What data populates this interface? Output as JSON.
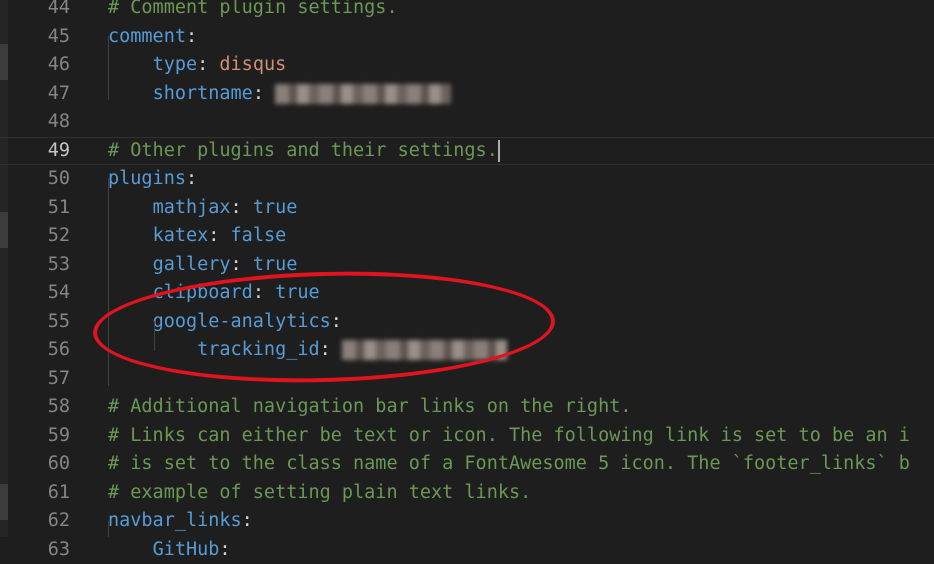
{
  "lines": [
    {
      "num": "44",
      "segments": [
        {
          "t": "c",
          "text": "# Comment plugin settings."
        }
      ]
    },
    {
      "num": "45",
      "segments": [
        {
          "t": "k",
          "text": "comment"
        },
        {
          "t": "p",
          "text": ":"
        }
      ]
    },
    {
      "num": "46",
      "segments": [
        {
          "t": "p",
          "text": "    "
        },
        {
          "t": "k",
          "text": "type"
        },
        {
          "t": "p",
          "text": ": "
        },
        {
          "t": "v",
          "text": "disqus"
        }
      ]
    },
    {
      "num": "47",
      "segments": [
        {
          "t": "p",
          "text": "    "
        },
        {
          "t": "k",
          "text": "shortname"
        },
        {
          "t": "p",
          "text": ": "
        },
        {
          "t": "redacted",
          "text": ""
        }
      ]
    },
    {
      "num": "48",
      "segments": []
    },
    {
      "num": "49",
      "current": true,
      "segments": [
        {
          "t": "c",
          "text": "# Other plugins and their settings."
        },
        {
          "t": "cursor",
          "text": ""
        }
      ]
    },
    {
      "num": "50",
      "segments": [
        {
          "t": "k",
          "text": "plugins"
        },
        {
          "t": "p",
          "text": ":"
        }
      ]
    },
    {
      "num": "51",
      "segments": [
        {
          "t": "p",
          "text": "    "
        },
        {
          "t": "k",
          "text": "mathjax"
        },
        {
          "t": "p",
          "text": ": "
        },
        {
          "t": "b",
          "text": "true"
        }
      ]
    },
    {
      "num": "52",
      "segments": [
        {
          "t": "p",
          "text": "    "
        },
        {
          "t": "k",
          "text": "katex"
        },
        {
          "t": "p",
          "text": ": "
        },
        {
          "t": "b",
          "text": "false"
        }
      ]
    },
    {
      "num": "53",
      "segments": [
        {
          "t": "p",
          "text": "    "
        },
        {
          "t": "k",
          "text": "gallery"
        },
        {
          "t": "p",
          "text": ": "
        },
        {
          "t": "b",
          "text": "true"
        }
      ]
    },
    {
      "num": "54",
      "segments": [
        {
          "t": "p",
          "text": "    "
        },
        {
          "t": "k",
          "text": "clipboard"
        },
        {
          "t": "p",
          "text": ": "
        },
        {
          "t": "b",
          "text": "true"
        }
      ]
    },
    {
      "num": "55",
      "segments": [
        {
          "t": "p",
          "text": "    "
        },
        {
          "t": "k",
          "text": "google-analytics"
        },
        {
          "t": "p",
          "text": ":"
        }
      ]
    },
    {
      "num": "56",
      "segments": [
        {
          "t": "p",
          "text": "        "
        },
        {
          "t": "k",
          "text": "tracking_id"
        },
        {
          "t": "p",
          "text": ": "
        },
        {
          "t": "redacted",
          "text": ""
        }
      ]
    },
    {
      "num": "57",
      "segments": []
    },
    {
      "num": "58",
      "segments": [
        {
          "t": "c",
          "text": "# Additional navigation bar links on the right."
        }
      ]
    },
    {
      "num": "59",
      "segments": [
        {
          "t": "c",
          "text": "# Links can either be text or icon. The following link is set to be an i"
        }
      ]
    },
    {
      "num": "60",
      "segments": [
        {
          "t": "c",
          "text": "# is set to the class name of a FontAwesome 5 icon. The `footer_links` b"
        }
      ]
    },
    {
      "num": "61",
      "segments": [
        {
          "t": "c",
          "text": "# example of setting plain text links."
        }
      ]
    },
    {
      "num": "62",
      "segments": [
        {
          "t": "k",
          "text": "navbar_links"
        },
        {
          "t": "p",
          "text": ":"
        }
      ]
    },
    {
      "num": "63",
      "segments": [
        {
          "t": "p",
          "text": "    "
        },
        {
          "t": "k",
          "text": "GitHub"
        },
        {
          "t": "p",
          "text": ":"
        }
      ]
    }
  ],
  "colors": {
    "key": "#569cd6",
    "string": "#ce9178",
    "comment": "#6a9955",
    "annotation": "#e0141e"
  }
}
